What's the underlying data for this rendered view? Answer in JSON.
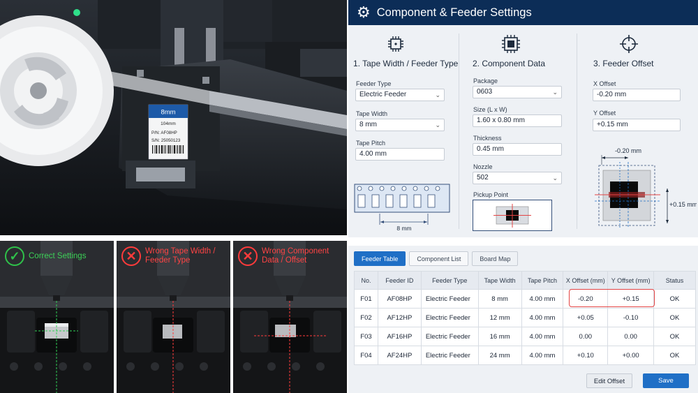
{
  "label_card": {
    "tape": "8mm",
    "length": "104mm",
    "part_number": "P/N: AF08HP",
    "serial_number": "S/N: 25050123"
  },
  "panels": [
    {
      "status": "ok",
      "icon": "check-icon",
      "caption": "Correct Settings"
    },
    {
      "status": "bad",
      "icon": "x-icon",
      "caption": "Wrong Tape Width / Feeder Type"
    },
    {
      "status": "bad",
      "icon": "x-icon",
      "caption": "Wrong Component Data / Offset"
    }
  ],
  "settings": {
    "title": "Component & Feeder Settings",
    "tape": {
      "title": "1. Tape Width / Feeder Type",
      "feeder_type_label": "Feeder Type",
      "feeder_type": "Electric Feeder",
      "tape_width_label": "Tape Width",
      "tape_width": "8 mm",
      "tape_pitch_label": "Tape Pitch",
      "tape_pitch": "4.00 mm",
      "diagram_dimension": "8 mm"
    },
    "component": {
      "title": "2. Component Data",
      "package_label": "Package",
      "package": "0603",
      "size_label": "Size (L x W)",
      "size": "1.60 x 0.80 mm",
      "thickness_label": "Thickness",
      "thickness": "0.45 mm",
      "nozzle_label": "Nozzle",
      "nozzle": "502",
      "pickup_label": "Pickup Point"
    },
    "offset": {
      "title": "3. Feeder Offset",
      "x_label": "X Offset",
      "x_value": "-0.20 mm",
      "y_label": "Y Offset",
      "y_value": "+0.15 mm",
      "diagram_x": "-0.20 mm",
      "diagram_y": "+0.15 mm"
    }
  },
  "feeder_table": {
    "tabs": [
      "Feeder Table",
      "Component List",
      "Board Map"
    ],
    "active_tab": "Feeder Table",
    "columns": [
      "No.",
      "Feeder ID",
      "Feeder Type",
      "Tape Width",
      "Tape Pitch",
      "X Offset (mm)",
      "Y Offset (mm)",
      "Status"
    ],
    "rows": [
      [
        "F01",
        "AF08HP",
        "Electric Feeder",
        "8 mm",
        "4.00 mm",
        "-0.20",
        "+0.15",
        "OK"
      ],
      [
        "F02",
        "AF12HP",
        "Electric Feeder",
        "12 mm",
        "4.00 mm",
        "+0.05",
        "-0.10",
        "OK"
      ],
      [
        "F03",
        "AF16HP",
        "Electric Feeder",
        "16 mm",
        "4.00 mm",
        "0.00",
        "0.00",
        "OK"
      ],
      [
        "F04",
        "AF24HP",
        "Electric Feeder",
        "24 mm",
        "4.00 mm",
        "+0.10",
        "+0.00",
        "OK"
      ]
    ],
    "edit_button": "Edit Offset",
    "save_button": "Save"
  },
  "colors": {
    "header": "#0c2d57",
    "accent": "#1f6fc6",
    "ok": "#2fc24a",
    "error": "#e34444"
  }
}
